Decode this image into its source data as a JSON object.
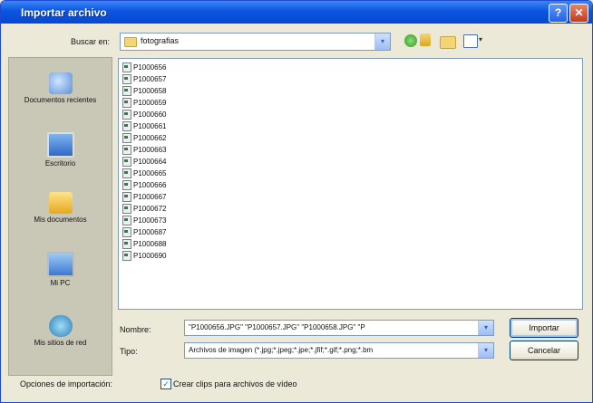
{
  "window": {
    "title": "Importar archivo",
    "help_glyph": "?",
    "close_glyph": "✕"
  },
  "toolbar": {
    "lookin_label": "Buscar en:",
    "lookin_value": "fotografias",
    "combo_arrow": "▾",
    "views_caret": "▾"
  },
  "places": [
    {
      "label": "Documentos recientes",
      "icon": "recent-documents-icon"
    },
    {
      "label": "Escritorio",
      "icon": "desktop-icon"
    },
    {
      "label": "Mis documentos",
      "icon": "my-documents-icon"
    },
    {
      "label": "Mi PC",
      "icon": "my-computer-icon"
    },
    {
      "label": "Mis sitios de red",
      "icon": "network-places-icon"
    }
  ],
  "files": [
    "P1000656",
    "P1000657",
    "P1000658",
    "P1000659",
    "P1000660",
    "P1000661",
    "P1000662",
    "P1000663",
    "P1000664",
    "P1000665",
    "P1000666",
    "P1000667",
    "P1000672",
    "P1000673",
    "P1000687",
    "P1000688",
    "P1000690"
  ],
  "bottom": {
    "name_label": "Nombre:",
    "name_value": "\"P1000656.JPG\" \"P1000657.JPG\" \"P1000658.JPG\" \"P",
    "type_label": "Tipo:",
    "type_value": "Archivos de imagen (*.jpg;*.jpeg;*.jpe;*.jfif;*.gif;*.png;*.bm",
    "import_button": "Importar",
    "cancel_button": "Cancelar",
    "options_label": "Opciones de importación:",
    "checkbox_label": "Crear clips para archivos de vídeo",
    "checkbox_checked": true,
    "check_glyph": "✓"
  }
}
